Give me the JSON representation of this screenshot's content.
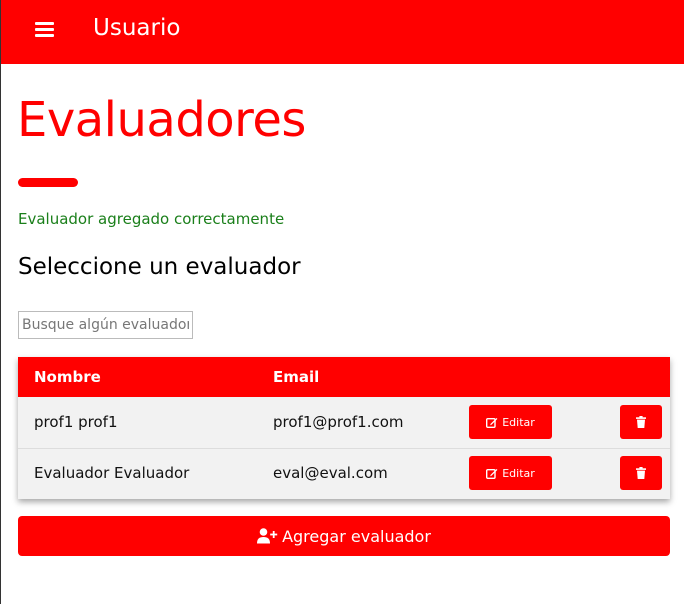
{
  "app_bar": {
    "title": "Usuario",
    "menu_icon": "hamburger-icon"
  },
  "page": {
    "title": "Evaluadores",
    "success_message": "Evaluador agregado correctamente",
    "section_heading": "Seleccione un evaluador"
  },
  "search": {
    "placeholder": "Busque algún evaluador",
    "value": ""
  },
  "table": {
    "columns": [
      "Nombre",
      "Email"
    ],
    "rows": [
      {
        "name": "prof1 prof1",
        "email": "prof1@prof1.com",
        "edit_label": "Editar",
        "delete_icon": "trash-icon"
      },
      {
        "name": "Evaluador Evaluador",
        "email": "eval@eval.com",
        "edit_label": "Editar",
        "delete_icon": "trash-icon"
      }
    ]
  },
  "actions": {
    "add_label": "Agregar evaluador",
    "add_icon": "user-plus-icon"
  },
  "colors": {
    "primary": "#ff0000",
    "success": "#1a7f1a",
    "row_bg": "#f2f2f2"
  }
}
